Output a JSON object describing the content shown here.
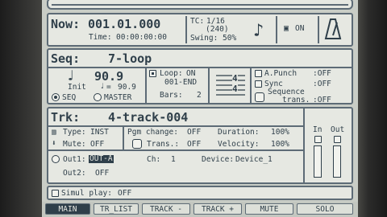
{
  "now": {
    "label": "Now:",
    "position": "001.01.000",
    "time_label": "Time:",
    "time": "00:00:00:00",
    "tc_label": "TC:",
    "tc_value": "1/16",
    "tempo": "(240)",
    "swing_label": "Swing:",
    "swing": "50%",
    "metronome_state": "ON"
  },
  "seq": {
    "label": "Seq:",
    "name": "7-loop",
    "tempo": "90.9",
    "init_label": "Init",
    "init_tempo": "90.9",
    "radio_seq": "SEQ",
    "radio_master": "MASTER",
    "loop_label": "Loop:",
    "loop_state": "ON",
    "loop_range": "001-END",
    "bars_label": "Bars:",
    "bars": "2",
    "time_sig_top": "4",
    "time_sig_bottom": "4",
    "apunch_label": "A.Punch",
    "apunch": ":OFF",
    "sync_label": "Sync",
    "sync": ":OFF",
    "seq_trans_label1": "Sequence",
    "seq_trans_label2": "trans.",
    "seq_trans": ":OFF"
  },
  "trk": {
    "label": "Trk:",
    "name": "4-track-004",
    "type_label": "Type:",
    "type": "INST",
    "mute_label": "Mute:",
    "mute": "OFF",
    "pgm_label": "Pgm change:",
    "pgm": "OFF",
    "trans_label": "Trans.:",
    "trans": "OFF",
    "duration_label": "Duration:",
    "duration": "100%",
    "velocity_label": "Velocity:",
    "velocity": "100%",
    "in_label": "In",
    "out_label": "Out",
    "out1_label": "Out1:",
    "out1": "OUT-A",
    "ch_label": "Ch:",
    "ch": "1",
    "device_label": "Device:",
    "device": "Device_1",
    "out2_label": "Out2:",
    "out2": "OFF"
  },
  "simul": {
    "label": "Simul play:",
    "value": "OFF"
  },
  "tabs": [
    "MAIN",
    "TR_LIST",
    "TRACK -",
    "TRACK +",
    "MUTE",
    "SOLO"
  ]
}
